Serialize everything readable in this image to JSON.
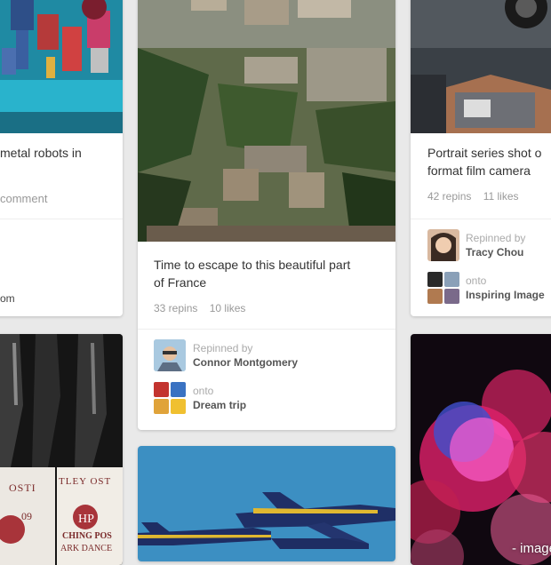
{
  "pins": [
    {
      "description": "metal robots in",
      "comment_text": "comment",
      "user_fragment": "om"
    },
    {
      "description": "Time to escape to this beautiful part of France",
      "repins": "33 repins",
      "likes": "10 likes",
      "repinned_by_label": "Repinned by",
      "repinned_by_name": "Connor Montgomery",
      "board_prefix": "onto",
      "board_name": "Dream trip"
    },
    {
      "description": "Portrait series shot o format film camera",
      "repins": "42 repins",
      "likes": "11 likes",
      "repinned_by_label": "Repinned by",
      "repinned_by_name": "Tracy Chou",
      "board_prefix": "onto",
      "board_name": "Inspiring Image"
    }
  ],
  "label_signs": {
    "line1": "TLEY OST",
    "line2": "OSTI",
    "line3": "09",
    "line4": "CHING POS",
    "line5": "ARK DANCE"
  },
  "caption": "- image"
}
